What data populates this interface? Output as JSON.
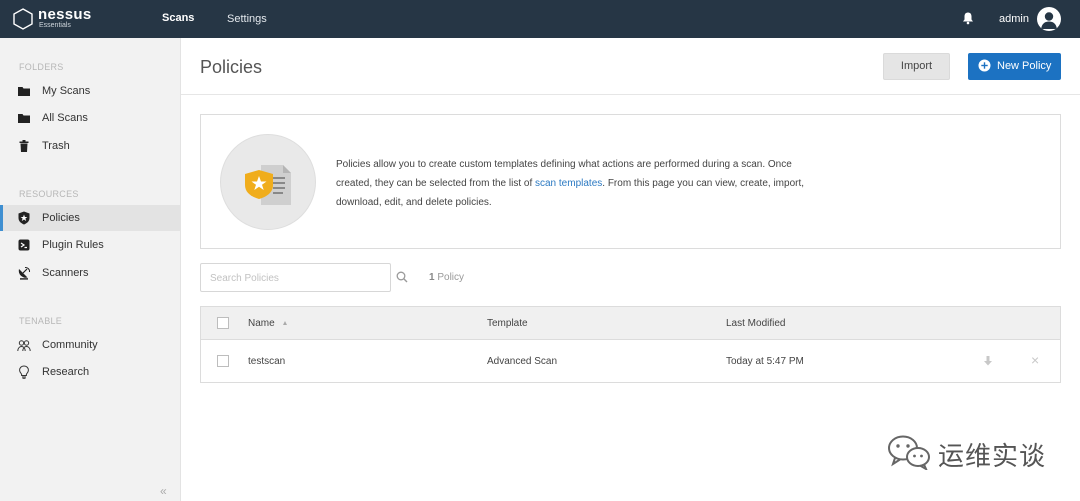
{
  "topbar": {
    "logo_name": "nessus",
    "logo_sub": "Essentials",
    "nav_scans": "Scans",
    "nav_settings": "Settings",
    "username": "admin"
  },
  "sidebar": {
    "folders_title": "FOLDERS",
    "resources_title": "RESOURCES",
    "tenable_title": "TENABLE",
    "items": [
      {
        "label": "My Scans",
        "icon": "folder-icon"
      },
      {
        "label": "All Scans",
        "icon": "folder-icon"
      },
      {
        "label": "Trash",
        "icon": "trash-icon"
      },
      {
        "label": "Policies",
        "icon": "shield-icon",
        "active": true
      },
      {
        "label": "Plugin Rules",
        "icon": "plugin-icon"
      },
      {
        "label": "Scanners",
        "icon": "satellite-dish-icon"
      },
      {
        "label": "Community",
        "icon": "people-icon"
      },
      {
        "label": "Research",
        "icon": "lightbulb-icon"
      }
    ],
    "collapse_glyph": "«"
  },
  "main": {
    "title": "Policies",
    "import_label": "Import",
    "new_policy_label": "New Policy",
    "info": {
      "text_1": "Policies allow you to create custom templates defining what actions are performed during a scan. Once created, they can be selected from the list of ",
      "link": "scan templates",
      "text_2": ". From this page you can view, create, import, download, edit, and delete policies."
    },
    "search_placeholder": "Search Policies",
    "count_number": "1",
    "count_label": "Policy",
    "table": {
      "headers": {
        "name": "Name",
        "template": "Template",
        "modified": "Last Modified"
      },
      "rows": [
        {
          "name": "testscan",
          "template": "Advanced Scan",
          "modified": "Today at 5:47 PM"
        }
      ]
    }
  },
  "watermark": {
    "text": "运维实谈"
  },
  "colors": {
    "topbar": "#263645",
    "accent": "#1c72c2",
    "active_border": "#3f8fd1",
    "shield": "#f0ad1c"
  }
}
